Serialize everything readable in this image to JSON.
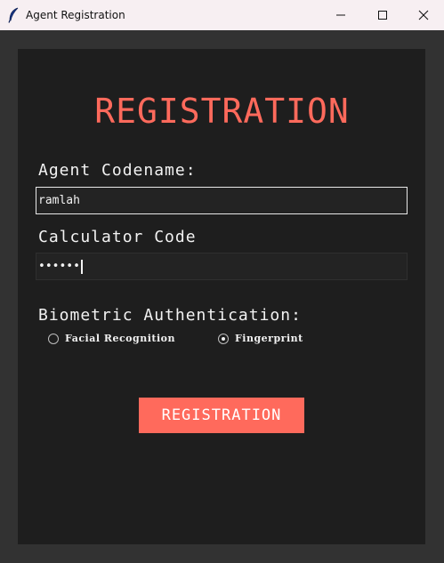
{
  "window": {
    "title": "Agent Registration",
    "icon": "feather-icon",
    "controls": [
      "minimize-icon",
      "maximize-icon",
      "close-icon"
    ]
  },
  "form": {
    "heading": "REGISTRATION",
    "codename_label": "Agent Codename:",
    "codename_value": "ramlah",
    "calculator_label": "Calculator Code",
    "calculator_value": "••••••",
    "biometric_label": "Biometric Authentication:",
    "biometric_options": [
      {
        "label": "Facial Recognition",
        "selected": false
      },
      {
        "label": "Fingerprint",
        "selected": true
      }
    ],
    "submit_label": "REGISTRATION"
  },
  "colors": {
    "accent": "#ff6a5c",
    "panel": "#1e1e1e",
    "background": "#323232",
    "text": "#f2f2f2"
  }
}
